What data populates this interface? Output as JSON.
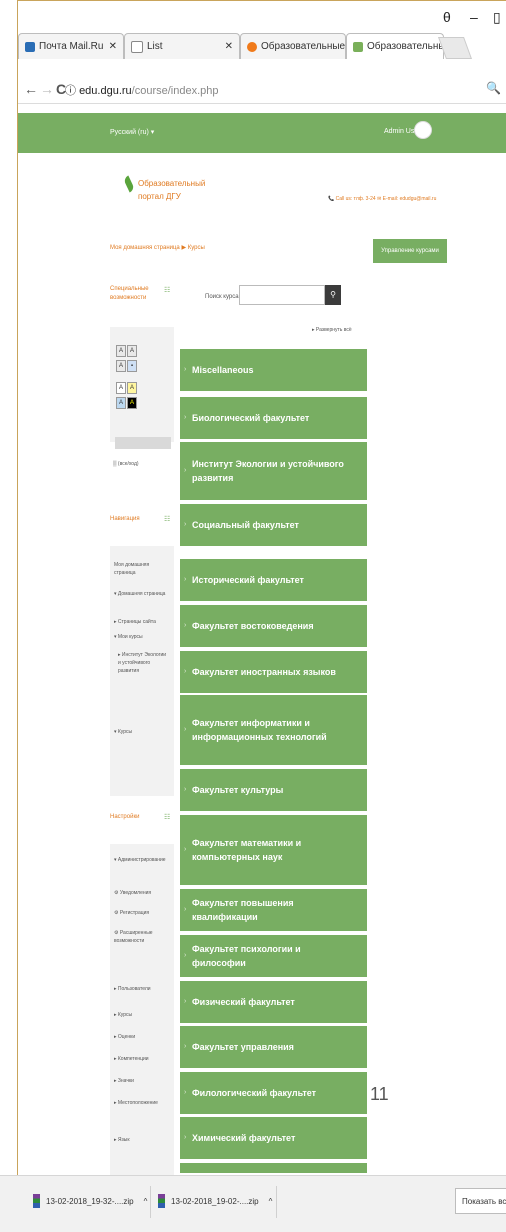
{
  "window_controls": {
    "mode_icon": "θ",
    "minimize": "–",
    "maximize": "▯"
  },
  "tabs": [
    {
      "label": "Почта Mail.Ru",
      "icon": "mail-icon",
      "color": "#2a6db5"
    },
    {
      "label": "List",
      "icon": "document-icon",
      "color": "#ffffff"
    },
    {
      "label": "Образовательные пр",
      "icon": "orange-logo-icon",
      "color": "#f07a1a"
    },
    {
      "label": "Образовательный пор",
      "icon": "leaf-icon",
      "color": "#7ab05a"
    }
  ],
  "address": {
    "domain": "edu.dgu.ru",
    "path": "/course/index.php"
  },
  "header": {
    "language": "Русский (ru) ▾",
    "user": "Admin User"
  },
  "logo": {
    "line1": "Образовательный",
    "line2": "портал ДГУ"
  },
  "contacts": "📞 Call us: тлф. 3-24  ✉ E-mail: edudgu@mail.ru",
  "breadcrumb": "Моя домашняя страница ▶ Курсы",
  "manage_button": "Управление курсами",
  "special_block_title": "Специальные возможности",
  "search": {
    "label": "Поиск курса:",
    "placeholder": ""
  },
  "expand_all": "▸ Развернуть всё",
  "all_label": "▒ (все/ход)",
  "navigation": {
    "title": "Навигация",
    "items": [
      "Моя домашняя страница",
      "▾ Домашняя страница",
      "▸ Страницы сайта",
      "▾ Мои курсы",
      "▸ Институт Экологии и устойчивого развития",
      "▾ Курсы"
    ]
  },
  "settings": {
    "title": "Настройки",
    "items": [
      "▾ Администрирование",
      "⚙ Уведомления",
      "⚙ Регистрация",
      "⚙ Расширенные возможности",
      "▸ Пользователи",
      "▸ Курсы",
      "▸ Оценки",
      "▸ Компетенции",
      "▸ Значки",
      "▸ Местоположение",
      "▸ Язык"
    ]
  },
  "categories": [
    "Miscellaneous",
    "Биологический факультет",
    "Институт Экологии и устойчивого развития",
    "Социальный факультет",
    "Исторический факультет",
    "Факультет востоковедения",
    "Факультет иностранных языков",
    "Факультет информатики и информационных технологий",
    "Факультет культуры",
    "Факультет математики и компьютерных наук",
    "Факультет повышения квалификации",
    "Факультет психологии и философии",
    "Физический факультет",
    "Факультет управления",
    "Филологический факультет",
    "Химический факультет"
  ],
  "page_number": "11",
  "downloads": [
    {
      "name": "13-02-2018_19-32-....zip",
      "chevron": "^"
    },
    {
      "name": "13-02-2018_19-02-....zip",
      "chevron": "^"
    }
  ],
  "show_all": "Показать все"
}
